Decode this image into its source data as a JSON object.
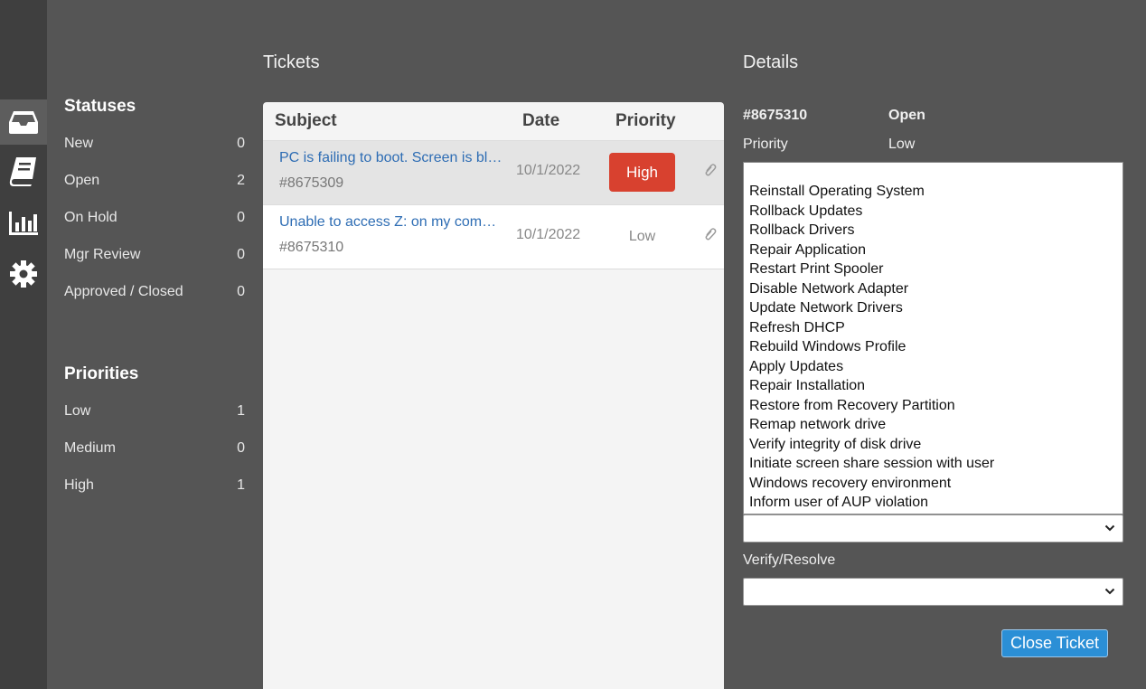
{
  "rail": {
    "items": [
      {
        "icon": "inbox-icon"
      },
      {
        "icon": "book-icon"
      },
      {
        "icon": "bar-chart-icon"
      },
      {
        "icon": "gear-icon"
      }
    ]
  },
  "sidebar": {
    "statuses_title": "Statuses",
    "statuses": [
      {
        "label": "New",
        "count": "0"
      },
      {
        "label": "Open",
        "count": "2"
      },
      {
        "label": "On Hold",
        "count": "0"
      },
      {
        "label": "Mgr Review",
        "count": "0"
      },
      {
        "label": "Approved / Closed",
        "count": "0"
      }
    ],
    "priorities_title": "Priorities",
    "priorities": [
      {
        "label": "Low",
        "count": "1"
      },
      {
        "label": "Medium",
        "count": "0"
      },
      {
        "label": "High",
        "count": "1"
      }
    ]
  },
  "tickets": {
    "title": "Tickets",
    "columns": {
      "subject": "Subject",
      "date": "Date",
      "priority": "Priority"
    },
    "rows": [
      {
        "subject": "PC is failing to boot. Screen is black",
        "id": "#8675309",
        "date": "10/1/2022",
        "priority": "High"
      },
      {
        "subject": "Unable to access Z: on my computer",
        "id": "#8675310",
        "date": "10/1/2022",
        "priority": "Low"
      }
    ]
  },
  "details": {
    "title": "Details",
    "ticket_id": "#8675310",
    "status": "Open",
    "priority_label": "Priority",
    "priority_value": "Low",
    "actions": [
      "",
      "Reinstall Operating System",
      "Rollback Updates",
      "Rollback Drivers",
      "Repair Application",
      "Restart Print Spooler",
      "Disable Network Adapter",
      "Update Network Drivers",
      "Refresh DHCP",
      "Rebuild Windows Profile",
      "Apply Updates",
      "Repair Installation",
      "Restore from Recovery Partition",
      "Remap network drive",
      "Verify integrity of disk drive",
      "Initiate screen share session with user",
      "Windows recovery environment",
      "Inform user of AUP violation"
    ],
    "action_select_value": "",
    "verify_label": "Verify/Resolve",
    "verify_select_value": "",
    "close_button": "Close Ticket"
  },
  "colors": {
    "accent": "#2b8fd6",
    "high": "#d8412f",
    "background": "#555555",
    "rail": "#3f3f3f"
  }
}
